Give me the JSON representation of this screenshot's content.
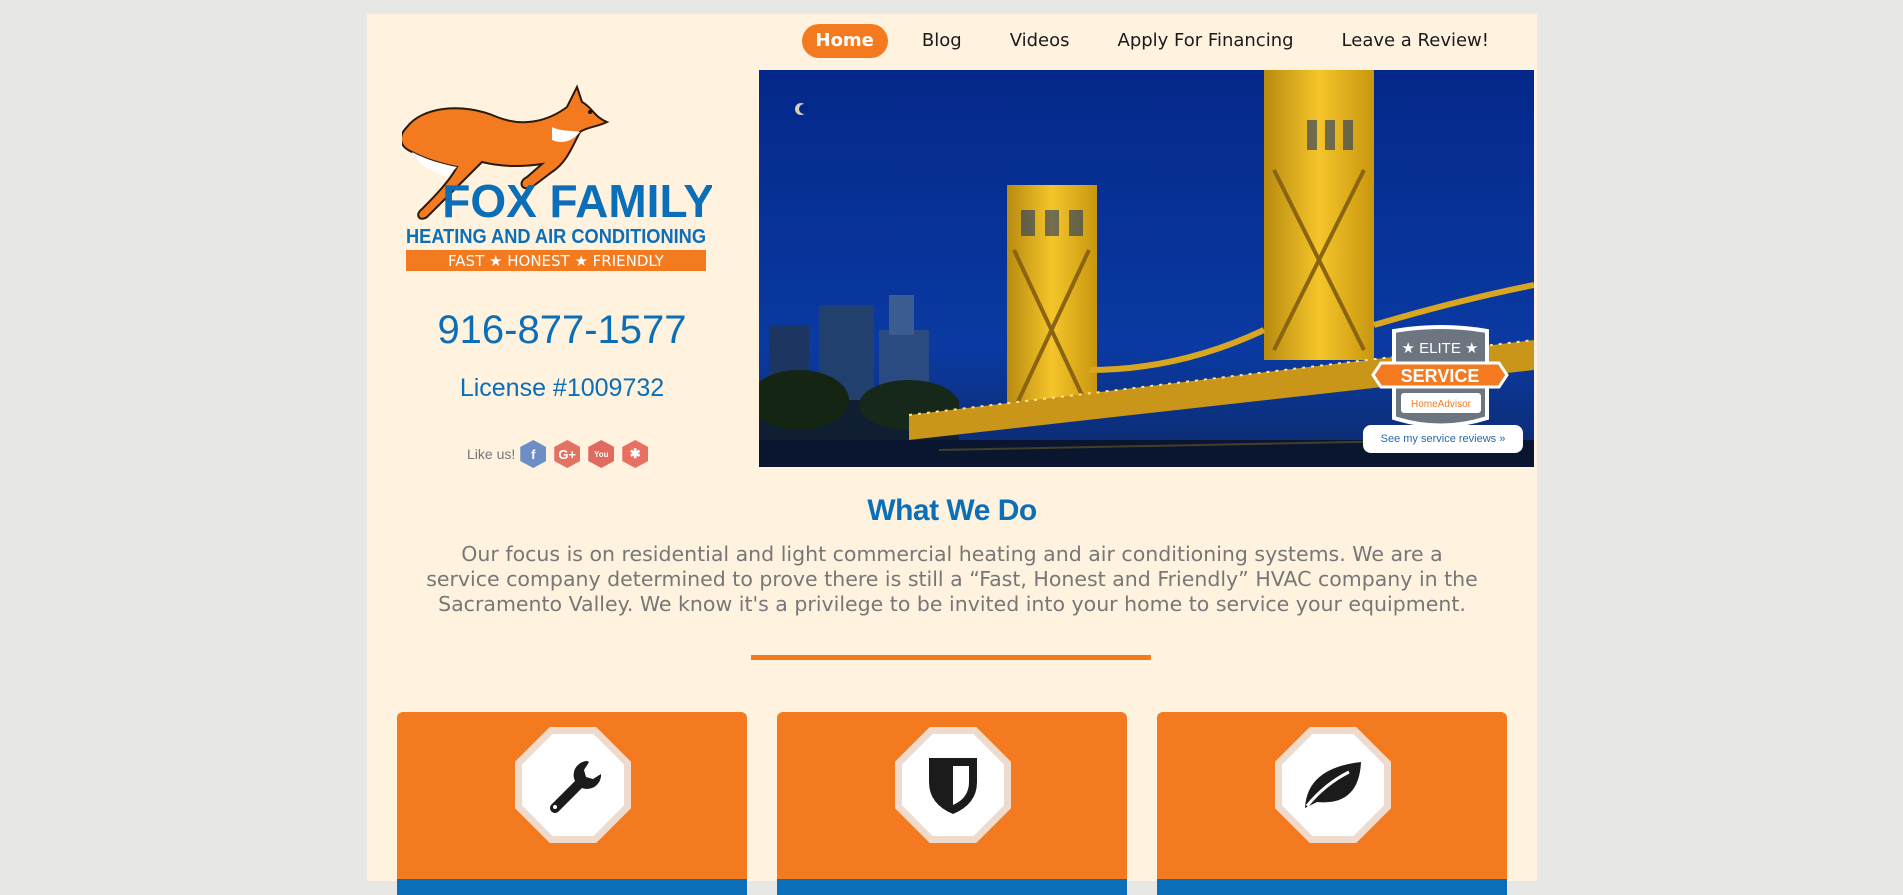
{
  "nav": {
    "items": [
      {
        "label": "Home",
        "active": true
      },
      {
        "label": "Blog",
        "active": false
      },
      {
        "label": "Videos",
        "active": false
      },
      {
        "label": "Apply For Financing",
        "active": false
      },
      {
        "label": "Leave a Review!",
        "active": false
      }
    ]
  },
  "logo": {
    "brand": "FOX FAMILY",
    "subtitle": "HEATING AND AIR CONDITIONING",
    "tagline": "FAST ★ HONEST ★ FRIENDLY"
  },
  "contact": {
    "phone": "916-877-1577",
    "license": "License #1009732"
  },
  "social": {
    "label": "Like us!",
    "icons": [
      "facebook-icon",
      "google-plus-icon",
      "youtube-icon",
      "yelp-icon"
    ]
  },
  "hero": {
    "badge_top": "★ ELITE ★",
    "badge_main": "SERVICE",
    "badge_brand": "HomeAdvisor",
    "reviews_link": "See my service reviews »"
  },
  "what_we_do": {
    "title": "What We Do",
    "text": "Our focus is on residential and light commercial heating and air conditioning systems. We are a service company determined to prove there is still a “Fast, Honest and Friendly” HVAC company in the Sacramento Valley. We know it's a privilege to be invited into your home to service your equipment."
  },
  "cards": [
    {
      "icon": "wrench-icon"
    },
    {
      "icon": "shield-icon"
    },
    {
      "icon": "leaf-icon"
    }
  ],
  "colors": {
    "accent": "#f47a20",
    "brand_blue": "#0b6eb8",
    "page_bg": "#fff2de"
  }
}
